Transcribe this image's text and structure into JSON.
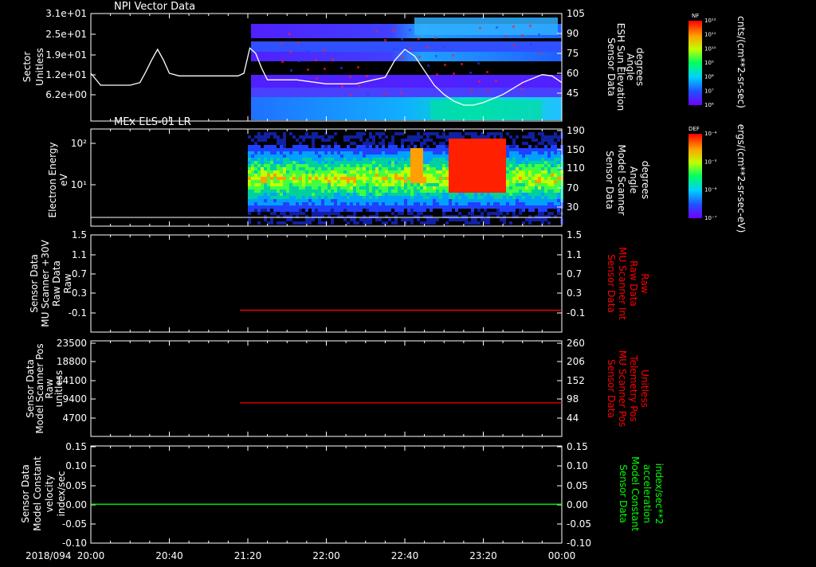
{
  "time_axis": {
    "date_label": "2018/094",
    "ticks": [
      "20:00",
      "20:40",
      "21:20",
      "22:00",
      "22:40",
      "23:20",
      "00:00"
    ],
    "start": "20:00",
    "end": "00:00"
  },
  "chart_data": [
    {
      "id": "npi",
      "type": "heatmap",
      "title": "NPI Vector Data",
      "ylabel_lines": [
        "Sector",
        "Unitless"
      ],
      "y_ticks": [
        "3.1e+01",
        "2.5e+01",
        "1.9e+01",
        "1.2e+01",
        "6.2e+00"
      ],
      "y2_label_lines": [
        "Sensor Data",
        "ESH Sun Elevation",
        "Angle",
        "degrees"
      ],
      "y2_ticks": [
        "105",
        "90",
        "75",
        "60",
        "45"
      ],
      "data_start": "21:20",
      "line_series": {
        "x": [
          "20:00",
          "20:05",
          "20:10",
          "20:15",
          "20:20",
          "20:25",
          "20:28",
          "20:31",
          "20:34",
          "20:37",
          "20:40",
          "20:45",
          "20:50",
          "20:55",
          "21:00",
          "21:05",
          "21:10",
          "21:15",
          "21:18",
          "21:21",
          "21:24",
          "21:27",
          "21:30",
          "21:45",
          "22:00",
          "22:15",
          "22:30",
          "22:35",
          "22:40",
          "22:45",
          "22:50",
          "22:55",
          "23:00",
          "23:05",
          "23:10",
          "23:15",
          "23:20",
          "23:30",
          "23:40",
          "23:50",
          "23:55",
          "00:00"
        ],
        "y": [
          60,
          51,
          51,
          51,
          51,
          53,
          61,
          70,
          78,
          70,
          60,
          58,
          58,
          58,
          58,
          58,
          58,
          58,
          60,
          79,
          75,
          64,
          55,
          55,
          52,
          52,
          57,
          70,
          78,
          73,
          62,
          51,
          44,
          39,
          36,
          36,
          38,
          44,
          53,
          59,
          58,
          53
        ],
        "color": "#ffffff"
      },
      "colorbar": {
        "label": "NF",
        "units": "cnts/(cm**2-sr-sec)",
        "ticks": [
          "10^12",
          "10^11",
          "10^10",
          "10^9",
          "10^8",
          "10^7",
          "10^6"
        ]
      }
    },
    {
      "id": "els",
      "type": "heatmap",
      "title": "MEx ELS-01 LR",
      "ylabel_lines": [
        "Electron Energy",
        "eV"
      ],
      "y_ticks": [
        "10^2",
        "10^1"
      ],
      "y2_label_lines": [
        "Sensor Data",
        "Model Scanner",
        "Angle",
        "degrees"
      ],
      "y2_ticks": [
        "190",
        "150",
        "110",
        "70",
        "30"
      ],
      "data_start": "21:20",
      "colorbar": {
        "label": "DEF",
        "units": "ergs/(cm**2-sr-sec-eV)",
        "ticks": [
          "10^-4",
          "10^-5",
          "10^-6",
          "10^-7"
        ]
      }
    },
    {
      "id": "mu_raw",
      "type": "line",
      "ylabel_lines": [
        "Sensor Data",
        "MU Scanner +30V",
        "Raw Data",
        "Raw"
      ],
      "y_ticks": [
        "1.5",
        "1.1",
        "0.7",
        "0.3",
        "-0.1"
      ],
      "y2_label_lines": [
        "Sensor Data",
        "MU Scanner Int",
        "Raw Data",
        "Raw"
      ],
      "y2_ticks": [
        "1.5",
        "1.1",
        "0.7",
        "0.3",
        "-0.1"
      ],
      "ylim": [
        -0.5,
        1.5
      ],
      "series": [
        {
          "x": [
            "21:16",
            "00:00"
          ],
          "y": [
            -0.05,
            -0.05
          ],
          "color": "#ff0000"
        }
      ]
    },
    {
      "id": "mu_pos",
      "type": "line",
      "ylabel_lines": [
        "Sensor Data",
        "Model Scanner Pos",
        "Raw",
        "unitless"
      ],
      "y_ticks": [
        "23500",
        "18800",
        "14100",
        "9400",
        "4700"
      ],
      "y2_label_lines": [
        "Sensor Data",
        "MU Scanner Pos",
        "Telemetry Pos",
        "Unitless"
      ],
      "y2_ticks": [
        "260",
        "206",
        "152",
        "98",
        "44"
      ],
      "ylim": [
        0,
        23500
      ],
      "series": [
        {
          "x": [
            "21:16",
            "00:00"
          ],
          "y": [
            8250,
            8250
          ],
          "color": "#ff0000"
        }
      ]
    },
    {
      "id": "model_const",
      "type": "line",
      "ylabel_lines": [
        "Sensor Data",
        "Model Constant",
        "velocity",
        "index/sec"
      ],
      "y_ticks": [
        "0.15",
        "0.10",
        "0.05",
        "0.00",
        "-0.05",
        "-0.10"
      ],
      "y2_label_lines": [
        "Sensor Data",
        "Model Constant",
        "acceleration",
        "index/sec**2"
      ],
      "y2_ticks": [
        "0.15",
        "0.10",
        "0.05",
        "0.00",
        "-0.05",
        "-0.10"
      ],
      "ylim": [
        -0.1,
        0.15
      ],
      "series": [
        {
          "x": [
            "20:00",
            "00:00"
          ],
          "y": [
            0,
            0
          ],
          "color": "#00ff00"
        }
      ]
    }
  ]
}
